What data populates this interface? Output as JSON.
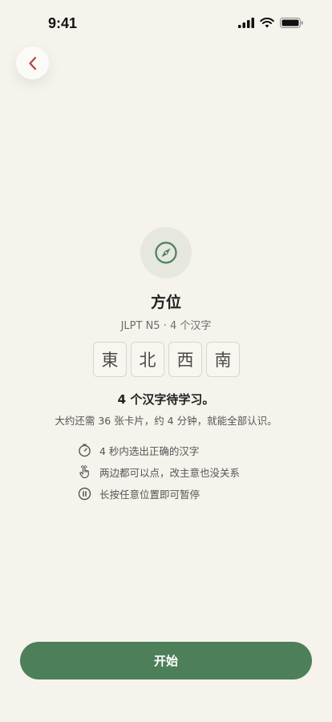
{
  "status_bar": {
    "time": "9:41"
  },
  "lesson": {
    "title": "方位",
    "subtitle": "JLPT N5 · 4 个汉字",
    "kanji": [
      "東",
      "北",
      "西",
      "南"
    ],
    "headline": "4 个汉字待学习。",
    "description": "大约还需 36 张卡片，约 4 分钟，就能全部认识。"
  },
  "tips": [
    {
      "icon": "timer-icon",
      "text": "4 秒内选出正确的汉字"
    },
    {
      "icon": "tap-hand-icon",
      "text": "两边都可以点，改主意也没关系"
    },
    {
      "icon": "pause-icon",
      "text": "长按任意位置即可暂停"
    }
  ],
  "actions": {
    "start_label": "开始"
  },
  "colors": {
    "accent": "#4e7f5b",
    "background": "#f5f3ec",
    "back_arrow": "#b5443c"
  }
}
